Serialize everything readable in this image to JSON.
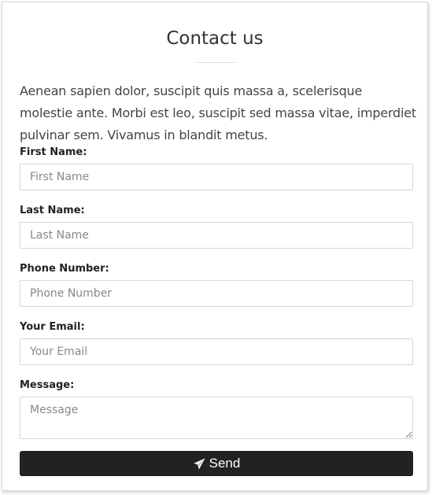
{
  "form": {
    "title": "Contact us",
    "intro": "Aenean sapien dolor, suscipit quis massa a, scelerisque molestie ante. Morbi est leo, suscipit sed massa vitae, imperdiet pulvinar sem. Vivamus in blandit metus.",
    "fields": {
      "first_name": {
        "label": "First Name:",
        "placeholder": "First Name",
        "value": ""
      },
      "last_name": {
        "label": "Last Name:",
        "placeholder": "Last Name",
        "value": ""
      },
      "phone": {
        "label": "Phone Number:",
        "placeholder": "Phone Number",
        "value": ""
      },
      "email": {
        "label": "Your Email:",
        "placeholder": "Your Email",
        "value": ""
      },
      "message": {
        "label": "Message:",
        "placeholder": "Message",
        "value": ""
      }
    },
    "submit": {
      "label": "Send",
      "icon": "paper-plane-icon",
      "color": "#222222"
    }
  }
}
